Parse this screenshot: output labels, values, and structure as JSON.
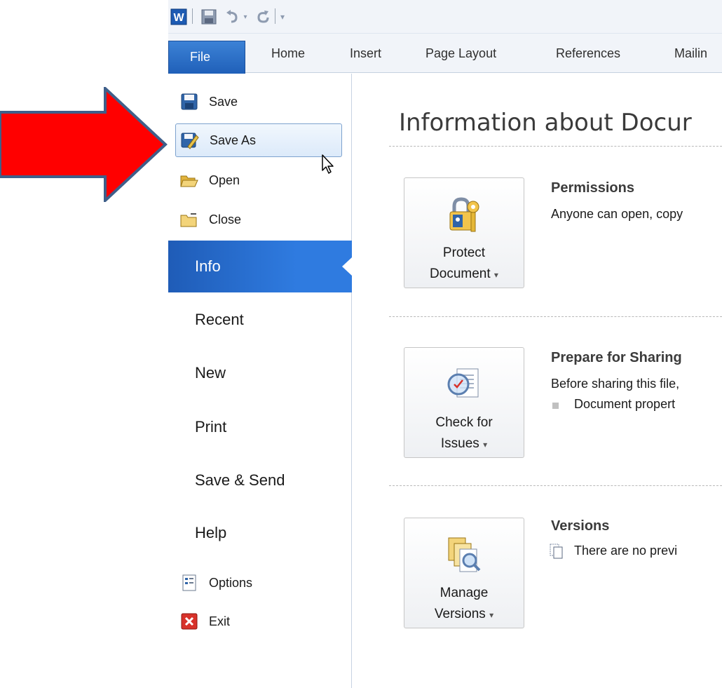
{
  "quick_access_toolbar": {
    "icons": [
      "word-logo-icon",
      "save-icon",
      "undo-icon",
      "undo-dropdown-icon",
      "redo-icon",
      "customize-toolbar-icon"
    ]
  },
  "ribbon": {
    "tabs": [
      "File",
      "Home",
      "Insert",
      "Page Layout",
      "References",
      "Mailin"
    ]
  },
  "backstage_menu": {
    "commands": [
      {
        "label": "Save",
        "icon": "save-icon"
      },
      {
        "label": "Save As",
        "icon": "save-as-icon"
      },
      {
        "label": "Open",
        "icon": "open-folder-icon"
      },
      {
        "label": "Close",
        "icon": "close-folder-icon"
      }
    ],
    "pages": [
      "Info",
      "Recent",
      "New",
      "Print",
      "Save & Send",
      "Help"
    ],
    "bottom": [
      {
        "label": "Options",
        "icon": "options-icon"
      },
      {
        "label": "Exit",
        "icon": "exit-icon"
      }
    ],
    "selected_page": "Info",
    "hovered_command": "Save As"
  },
  "info_panel": {
    "title": "Information about Docur",
    "sections": [
      {
        "button_line1": "Protect",
        "button_line2": "Document",
        "heading": "Permissions",
        "text": "Anyone can open, copy",
        "icon": "lock-key-icon"
      },
      {
        "button_line1": "Check for",
        "button_line2": "Issues",
        "heading": "Prepare for Sharing",
        "text": "Before sharing this file,",
        "bullet": "Document propert",
        "icon": "inspect-document-icon"
      },
      {
        "button_line1": "Manage",
        "button_line2": "Versions",
        "heading": "Versions",
        "text": "There are no previ",
        "icon": "versions-icon"
      }
    ],
    "dropdown_caret": "▾"
  },
  "colors": {
    "file_tab": "#2a6fca",
    "info_selected": "#2a6fca",
    "annotation_arrow": "#ff0000",
    "annotation_outline": "#3f5f8a"
  }
}
